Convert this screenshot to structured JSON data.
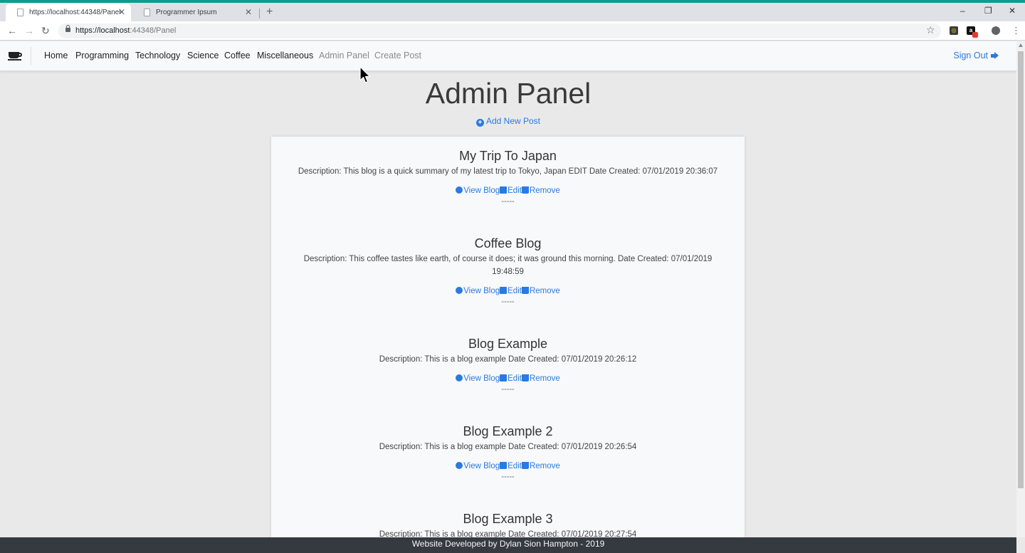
{
  "browser": {
    "tabs": [
      {
        "title": "https://localhost:44348/Panel",
        "active": true
      },
      {
        "title": "Programmer Ipsum",
        "active": false
      }
    ],
    "url_scheme": "https://",
    "url_host": "localhost",
    "url_rest": ":44348/Panel"
  },
  "nav": {
    "links": [
      "Home",
      "Programming",
      "Technology",
      "Science",
      "Coffee",
      "Miscellaneous",
      "Admin Panel",
      "Create Post"
    ],
    "sign_out": "Sign Out"
  },
  "page": {
    "title": "Admin Panel",
    "add_new_post": "Add New Post"
  },
  "posts": [
    {
      "title": "My Trip To Japan",
      "description": "Description: This blog is a quick summary of my latest trip to Tokyo, Japan EDIT Date Created: 07/01/2019 20:36:07"
    },
    {
      "title": "Coffee Blog",
      "description": "Description: This coffee tastes like earth, of course it does; it was ground this morning. Date Created: 07/01/2019 19:48:59"
    },
    {
      "title": "Blog Example",
      "description": "Description: This is a blog example Date Created: 07/01/2019 20:26:12"
    },
    {
      "title": "Blog Example 2",
      "description": "Description: This is a blog example Date Created: 07/01/2019 20:26:54"
    },
    {
      "title": "Blog Example 3",
      "description": "Description: This is a blog example Date Created: 07/01/2019 20:27:54"
    }
  ],
  "actions": {
    "view": "View Blog",
    "edit": "Edit",
    "remove": "Remove",
    "separator": "-----"
  },
  "footer": {
    "text": "Website Developed by Dylan Sion Hampton - 2019"
  },
  "colors": {
    "link": "#2a7ae2",
    "footer_bg": "#343a40",
    "accent_strip": "#0f9c8f"
  }
}
